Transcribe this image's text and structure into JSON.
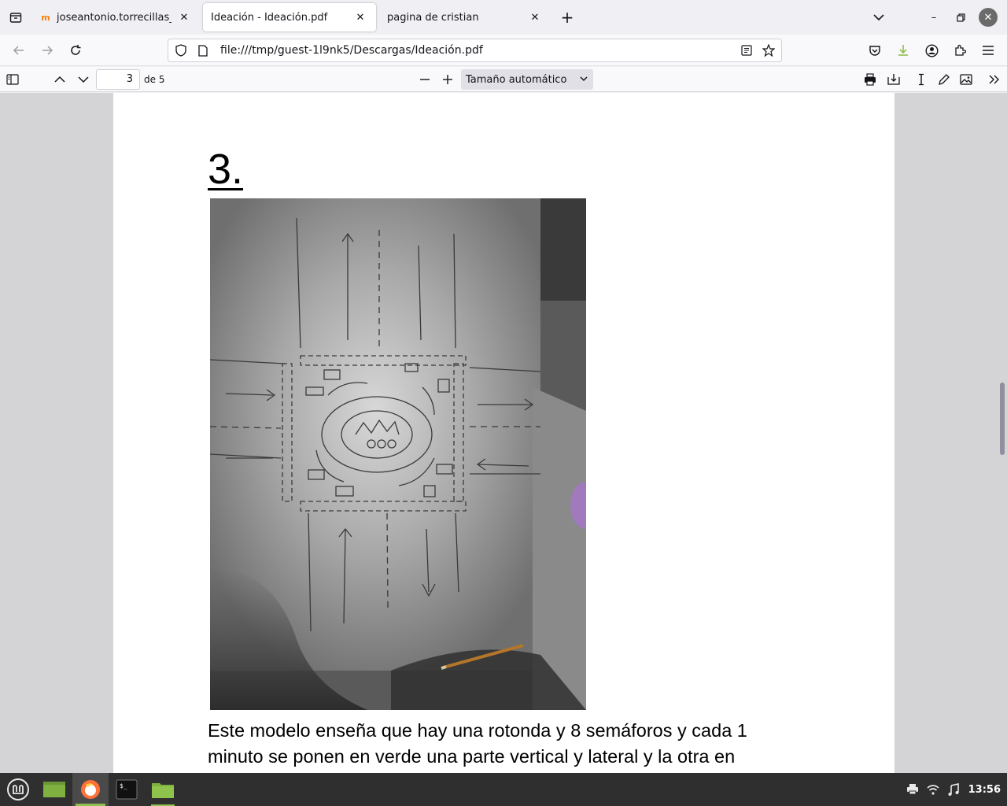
{
  "browser": {
    "tabs": [
      {
        "label": "joseantonio.torrecillas_TD_",
        "favicon": "moodle-icon",
        "active": false
      },
      {
        "label": "Ideación - Ideación.pdf",
        "favicon": "",
        "active": true
      },
      {
        "label": "pagina de cristian",
        "favicon": "",
        "active": false
      }
    ],
    "url": "file:///tmp/guest-1l9nk5/Descargas/Ideación.pdf"
  },
  "pdf_toolbar": {
    "page_number": "3",
    "page_of": "de 5",
    "zoom_value": "Tamaño automático"
  },
  "document": {
    "heading": "3.",
    "photo_description_icon": "hand-drawn-roundabout-sketch",
    "paragraph_line1": "Este modelo enseña que hay una rotonda y 8 semáforos y cada 1",
    "paragraph_line2": "minuto se ponen en verde una parte vertical y lateral y la otra en"
  },
  "taskbar": {
    "clock": "13:56"
  },
  "colors": {
    "accent_green": "#8fbf4c",
    "firefox_orange": "#ff7139",
    "taskbar_bg": "#2f2f2f"
  }
}
